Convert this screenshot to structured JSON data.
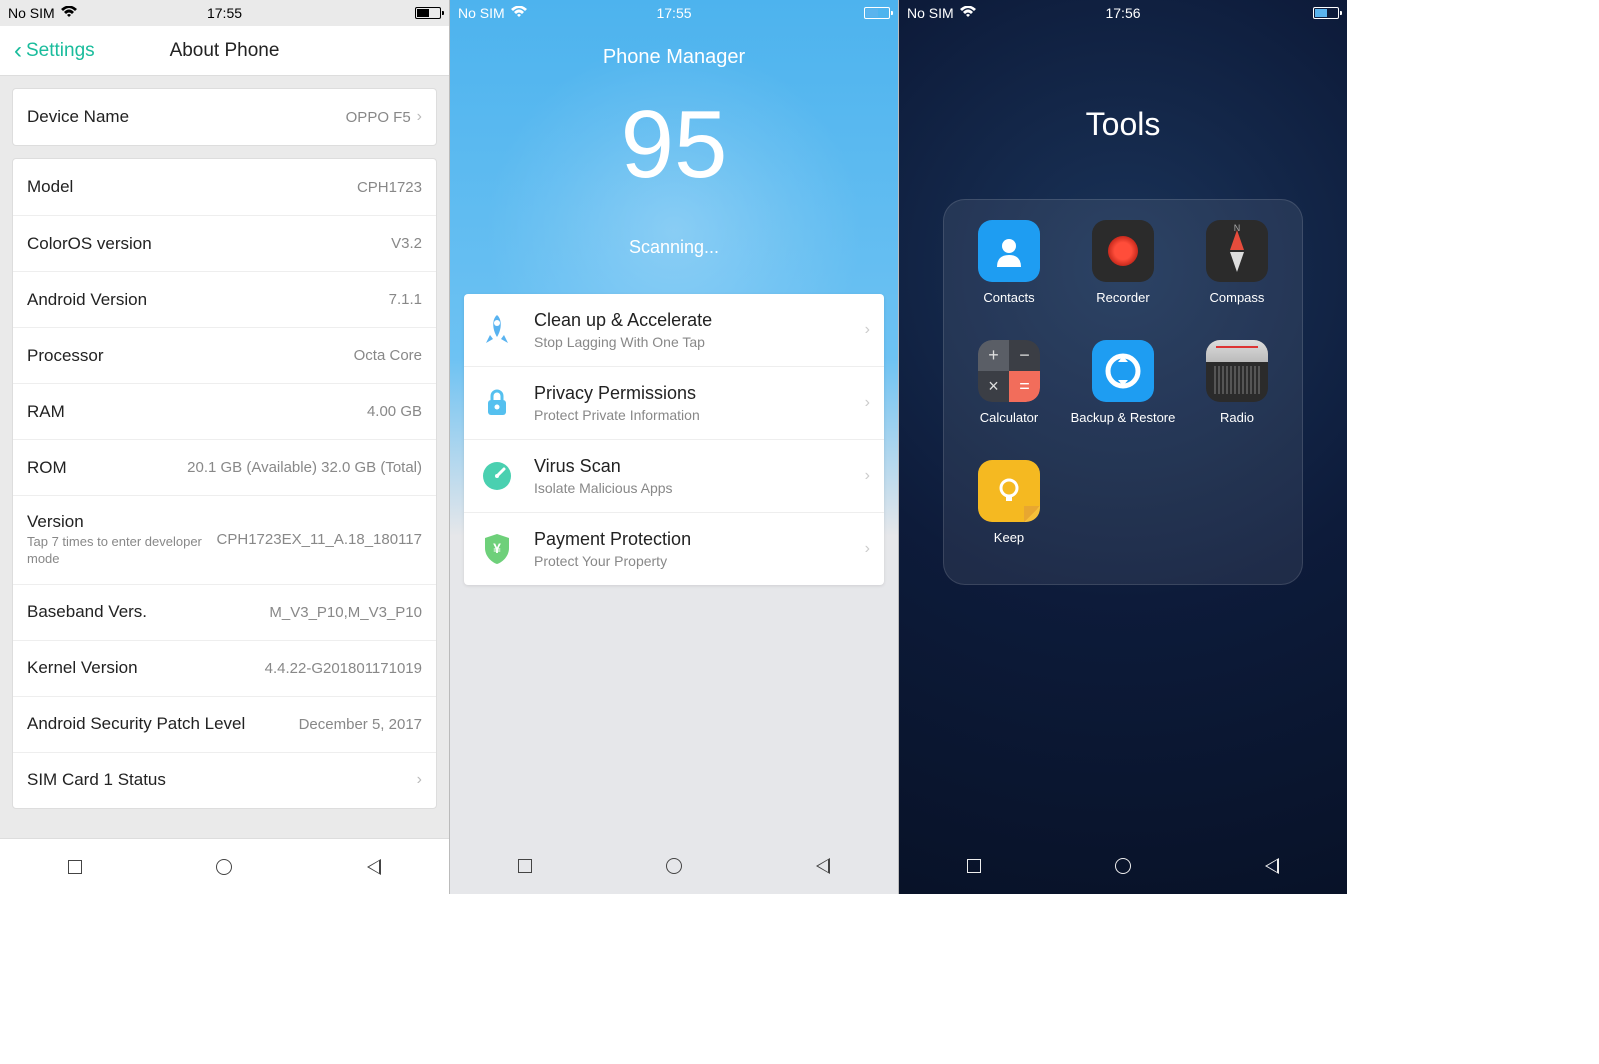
{
  "screen1": {
    "status": {
      "sim": "No SIM",
      "time": "17:55"
    },
    "header": {
      "back": "Settings",
      "title": "About Phone"
    },
    "device_name": {
      "label": "Device Name",
      "value": "OPPO F5"
    },
    "rows": [
      {
        "label": "Model",
        "value": "CPH1723"
      },
      {
        "label": "ColorOS version",
        "value": "V3.2"
      },
      {
        "label": "Android Version",
        "value": "7.1.1"
      },
      {
        "label": "Processor",
        "value": "Octa Core"
      },
      {
        "label": "RAM",
        "value": "4.00 GB"
      },
      {
        "label": "ROM",
        "value": "20.1 GB (Available)   32.0 GB (Total)"
      },
      {
        "label": "Version",
        "sub": "Tap 7 times to enter developer mode",
        "value": "CPH1723EX_11_A.18_180117"
      },
      {
        "label": "Baseband Vers.",
        "value": "M_V3_P10,M_V3_P10"
      },
      {
        "label": "Kernel Version",
        "value": "4.4.22-G201801171019"
      },
      {
        "label": "Android Security Patch Level",
        "value": "December 5, 2017"
      },
      {
        "label": "SIM Card 1 Status",
        "value": ""
      }
    ]
  },
  "screen2": {
    "status": {
      "sim": "No SIM",
      "time": "17:55"
    },
    "title": "Phone Manager",
    "score": "95",
    "status_text": "Scanning...",
    "items": [
      {
        "title": "Clean up & Accelerate",
        "sub": "Stop Lagging With One Tap",
        "icon": "rocket",
        "color": "#59b3f0"
      },
      {
        "title": "Privacy Permissions",
        "sub": "Protect Private Information",
        "icon": "lock",
        "color": "#55c0ef"
      },
      {
        "title": "Virus Scan",
        "sub": "Isolate Malicious Apps",
        "icon": "gauge",
        "color": "#4ad0b0"
      },
      {
        "title": "Payment Protection",
        "sub": "Protect Your Property",
        "icon": "shield",
        "color": "#6ed07a"
      }
    ]
  },
  "screen3": {
    "status": {
      "sim": "No SIM",
      "time": "17:56"
    },
    "folder_title": "Tools",
    "apps": [
      {
        "name": "Contacts",
        "icon": "contacts",
        "bg": "#1e9df2"
      },
      {
        "name": "Recorder",
        "icon": "recorder",
        "bg": "#2b2b2b"
      },
      {
        "name": "Compass",
        "icon": "compass",
        "bg": "#2b2b2b"
      },
      {
        "name": "Calculator",
        "icon": "calculator",
        "bg": ""
      },
      {
        "name": "Backup & Restore",
        "icon": "backup",
        "bg": "#1e9df2"
      },
      {
        "name": "Radio",
        "icon": "radio",
        "bg": "#2b2b2b"
      },
      {
        "name": "Keep",
        "icon": "keep",
        "bg": "#f5b921"
      }
    ]
  }
}
